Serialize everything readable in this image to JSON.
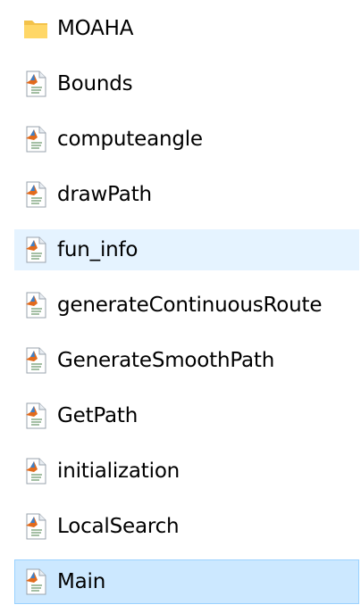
{
  "files": [
    {
      "name": "MOAHA",
      "icon": "folder-icon",
      "state": "normal"
    },
    {
      "name": "Bounds",
      "icon": "matlab-file-icon",
      "state": "normal"
    },
    {
      "name": "computeangle",
      "icon": "matlab-file-icon",
      "state": "normal"
    },
    {
      "name": "drawPath",
      "icon": "matlab-file-icon",
      "state": "normal"
    },
    {
      "name": "fun_info",
      "icon": "matlab-file-icon",
      "state": "hover"
    },
    {
      "name": "generateContinuousRoute",
      "icon": "matlab-file-icon",
      "state": "normal"
    },
    {
      "name": "GenerateSmoothPath",
      "icon": "matlab-file-icon",
      "state": "normal"
    },
    {
      "name": "GetPath",
      "icon": "matlab-file-icon",
      "state": "normal"
    },
    {
      "name": "initialization",
      "icon": "matlab-file-icon",
      "state": "normal"
    },
    {
      "name": "LocalSearch",
      "icon": "matlab-file-icon",
      "state": "normal"
    },
    {
      "name": "Main",
      "icon": "matlab-file-icon",
      "state": "selected"
    }
  ],
  "colors": {
    "hover": "#e5f3ff",
    "selected": "#cce8ff",
    "selected_border": "#99d1ff",
    "folder": "#f3c24a",
    "matlab_orange": "#e16a1c"
  }
}
